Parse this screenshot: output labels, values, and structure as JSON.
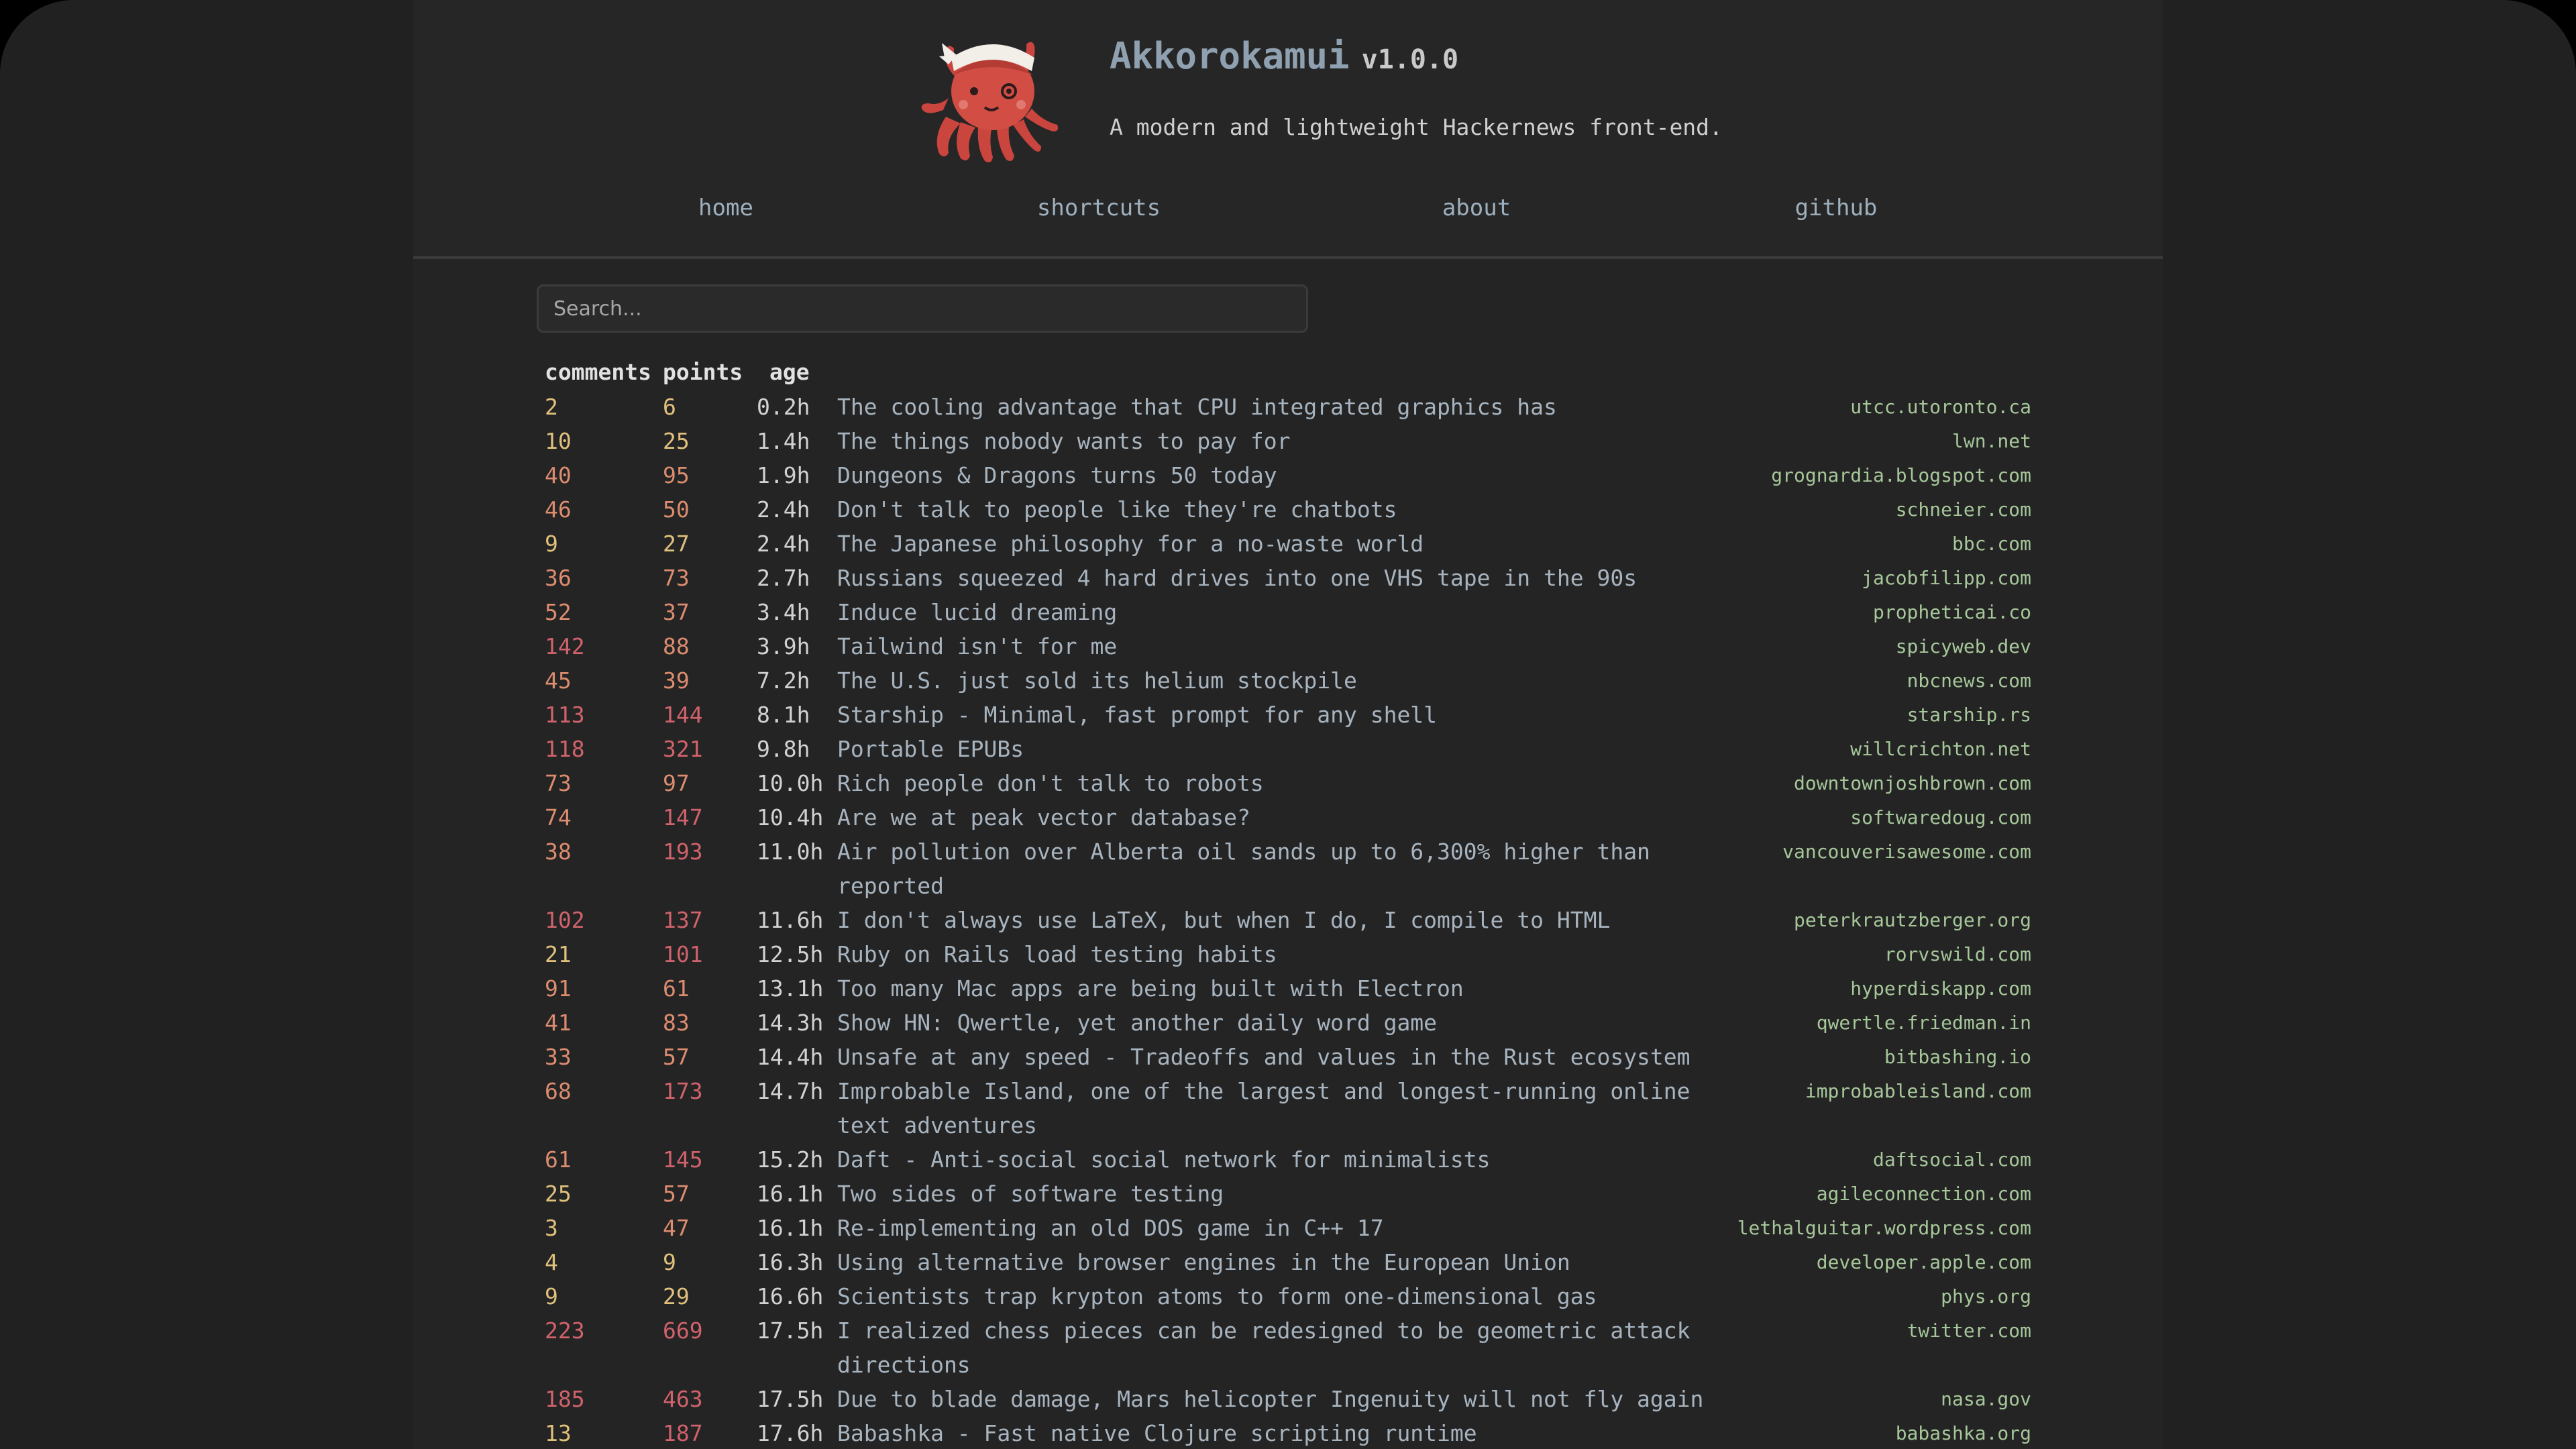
{
  "app": {
    "name": "Akkorokamui",
    "version": "v1.0.0",
    "tagline": "A modern and lightweight Hackernews front-end."
  },
  "nav": [
    {
      "label": "home"
    },
    {
      "label": "shortcuts"
    },
    {
      "label": "about"
    },
    {
      "label": "github"
    }
  ],
  "search": {
    "placeholder": "Search...",
    "value": ""
  },
  "columns": {
    "comments": "comments",
    "points": "points",
    "age": "age"
  },
  "colors": {
    "background": "#212121",
    "title": "#a7b4bf",
    "domain": "#a6c79a",
    "heat_low": "#e0c17c",
    "heat_mid": "#dc8c6f",
    "heat_high": "#d0626b"
  },
  "stories": [
    {
      "comments": "2",
      "points": "6",
      "age": "0.2h",
      "title": "The cooling advantage that CPU integrated graphics has",
      "domain": "utcc.utoronto.ca"
    },
    {
      "comments": "10",
      "points": "25",
      "age": "1.4h",
      "title": "The things nobody wants to pay for",
      "domain": "lwn.net"
    },
    {
      "comments": "40",
      "points": "95",
      "age": "1.9h",
      "title": "Dungeons & Dragons turns 50 today",
      "domain": "grognardia.blogspot.com"
    },
    {
      "comments": "46",
      "points": "50",
      "age": "2.4h",
      "title": "Don't talk to people like they're chatbots",
      "domain": "schneier.com"
    },
    {
      "comments": "9",
      "points": "27",
      "age": "2.4h",
      "title": "The Japanese philosophy for a no-waste world",
      "domain": "bbc.com"
    },
    {
      "comments": "36",
      "points": "73",
      "age": "2.7h",
      "title": "Russians squeezed 4 hard drives into one VHS tape in the 90s",
      "domain": "jacobfilipp.com"
    },
    {
      "comments": "52",
      "points": "37",
      "age": "3.4h",
      "title": "Induce lucid dreaming",
      "domain": "propheticai.co"
    },
    {
      "comments": "142",
      "points": "88",
      "age": "3.9h",
      "title": "Tailwind isn't for me",
      "domain": "spicyweb.dev"
    },
    {
      "comments": "45",
      "points": "39",
      "age": "7.2h",
      "title": "The U.S. just sold its helium stockpile",
      "domain": "nbcnews.com"
    },
    {
      "comments": "113",
      "points": "144",
      "age": "8.1h",
      "title": "Starship - Minimal, fast prompt for any shell",
      "domain": "starship.rs"
    },
    {
      "comments": "118",
      "points": "321",
      "age": "9.8h",
      "title": "Portable EPUBs",
      "domain": "willcrichton.net"
    },
    {
      "comments": "73",
      "points": "97",
      "age": "10.0h",
      "title": "Rich people don't talk to robots",
      "domain": "downtownjoshbrown.com"
    },
    {
      "comments": "74",
      "points": "147",
      "age": "10.4h",
      "title": "Are we at peak vector database?",
      "domain": "softwaredoug.com"
    },
    {
      "comments": "38",
      "points": "193",
      "age": "11.0h",
      "title": "Air pollution over Alberta oil sands up to 6,300% higher than reported",
      "domain": "vancouverisawesome.com"
    },
    {
      "comments": "102",
      "points": "137",
      "age": "11.6h",
      "title": "I don't always use LaTeX, but when I do, I compile to HTML",
      "domain": "peterkrautzberger.org"
    },
    {
      "comments": "21",
      "points": "101",
      "age": "12.5h",
      "title": "Ruby on Rails load testing habits",
      "domain": "rorvswild.com"
    },
    {
      "comments": "91",
      "points": "61",
      "age": "13.1h",
      "title": "Too many Mac apps are being built with Electron",
      "domain": "hyperdiskapp.com"
    },
    {
      "comments": "41",
      "points": "83",
      "age": "14.3h",
      "title": "Show HN: Qwertle, yet another daily word game",
      "domain": "qwertle.friedman.in"
    },
    {
      "comments": "33",
      "points": "57",
      "age": "14.4h",
      "title": "Unsafe at any speed - Tradeoffs and values in the Rust ecosystem",
      "domain": "bitbashing.io"
    },
    {
      "comments": "68",
      "points": "173",
      "age": "14.7h",
      "title": "Improbable Island, one of the largest and longest-running online text adventures",
      "domain": "improbableisland.com"
    },
    {
      "comments": "61",
      "points": "145",
      "age": "15.2h",
      "title": "Daft - Anti-social social network for minimalists",
      "domain": "daftsocial.com"
    },
    {
      "comments": "25",
      "points": "57",
      "age": "16.1h",
      "title": "Two sides of software testing",
      "domain": "agileconnection.com"
    },
    {
      "comments": "3",
      "points": "47",
      "age": "16.1h",
      "title": "Re-implementing an old DOS game in C++ 17",
      "domain": "lethalguitar.wordpress.com"
    },
    {
      "comments": "4",
      "points": "9",
      "age": "16.3h",
      "title": "Using alternative browser engines in the European Union",
      "domain": "developer.apple.com"
    },
    {
      "comments": "9",
      "points": "29",
      "age": "16.6h",
      "title": "Scientists trap krypton atoms to form one-dimensional gas",
      "domain": "phys.org"
    },
    {
      "comments": "223",
      "points": "669",
      "age": "17.5h",
      "title": "I realized chess pieces can be redesigned to be geometric attack directions",
      "domain": "twitter.com"
    },
    {
      "comments": "185",
      "points": "463",
      "age": "17.5h",
      "title": "Due to blade damage, Mars helicopter Ingenuity will not fly again",
      "domain": "nasa.gov"
    },
    {
      "comments": "13",
      "points": "187",
      "age": "17.6h",
      "title": "Babashka - Fast native Clojure scripting runtime",
      "domain": "babashka.org"
    }
  ]
}
